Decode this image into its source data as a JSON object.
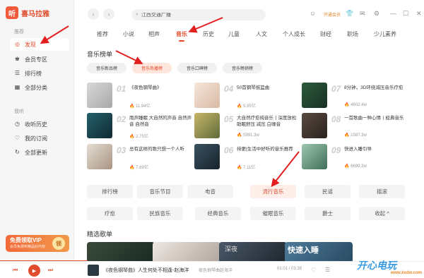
{
  "app": {
    "logo_char": "听",
    "name": "喜马拉雅"
  },
  "sidebar": {
    "section_recommend": "推荐",
    "items_top": [
      {
        "label": "发现",
        "icon": "discover-icon",
        "active": true
      },
      {
        "label": "会员专区",
        "icon": "vip-zone-icon"
      },
      {
        "label": "排行榜",
        "icon": "ranking-icon"
      },
      {
        "label": "全部分类",
        "icon": "grid-icon"
      }
    ],
    "section_mine": "我听",
    "items_mine": [
      {
        "label": "收听历史",
        "icon": "history-icon"
      },
      {
        "label": "我的订阅",
        "icon": "subscribe-icon"
      },
      {
        "label": "全部更新",
        "icon": "refresh-icon"
      }
    ],
    "vip_banner": {
      "title": "免费领取VIP",
      "subtitle": "会员免费听精品好内容",
      "coin": "领"
    }
  },
  "topbar": {
    "search_value": "江西交通广播",
    "open_vip": "开通会员"
  },
  "tabs": [
    "推荐",
    "小说",
    "相声",
    "音乐",
    "历史",
    "儿童",
    "人文",
    "个人成长",
    "财经",
    "职场",
    "少儿素养"
  ],
  "active_tab": "音乐",
  "music_ranking": {
    "heading": "音乐榜单",
    "tabs": [
      "音乐新品榜",
      "音乐热播榜",
      "音乐口碑榜",
      "音乐畅销榜"
    ],
    "active": "音乐热播榜",
    "items": [
      {
        "rank": "01",
        "title": "《夜色钢琴曲》",
        "plays": "11.94亿"
      },
      {
        "rank": "02",
        "title": "雨声睡眠 大自然的声音 自然声音 自然音",
        "plays": "2.75亿"
      },
      {
        "rank": "03",
        "title": "总有这样的歌只想一个人听",
        "plays": "7.69亿"
      },
      {
        "rank": "04",
        "title": "50首钢琴摇篮曲",
        "plays": "5.95亿"
      },
      {
        "rank": "05",
        "title": "大自然疗愈纯音乐丨深度放松 助眠舒压 减压 白噪音",
        "plays": "5991.3w"
      },
      {
        "rank": "06",
        "title": "持更|生活中好听的音乐推荐",
        "plays": "7.11亿"
      },
      {
        "rank": "07",
        "title": "8分钟，3D环绕减压音乐疗愈",
        "plays": "4602.4w"
      },
      {
        "rank": "08",
        "title": "一首歌曲一种心情丨经典音乐",
        "plays": "1587.3w"
      },
      {
        "rank": "09",
        "title": "快进入睡引导",
        "plays": "6699.3w"
      }
    ]
  },
  "categories": [
    "排行榜",
    "音乐节目",
    "电音",
    "流行音乐",
    "民谣",
    "摇滚",
    "疗愈",
    "民族音乐",
    "经典音乐",
    "催眠音乐",
    "爵士",
    "收起 ^"
  ],
  "active_category": "流行音乐",
  "playlist_heading": "精选歌单",
  "playlists": [
    {
      "label": ""
    },
    {
      "label": ""
    },
    {
      "label": "深夜"
    },
    {
      "label": ""
    },
    {
      "label": "快速入睡"
    }
  ],
  "player": {
    "track": "《夜色钢琴曲》人生何处不相逢-赵海洋",
    "artist": "夜色钢琴曲赵海洋",
    "time": "01:01 / 03:38"
  },
  "watermark": {
    "brand": "开心电玩",
    "url": "www.kxdw.com"
  }
}
